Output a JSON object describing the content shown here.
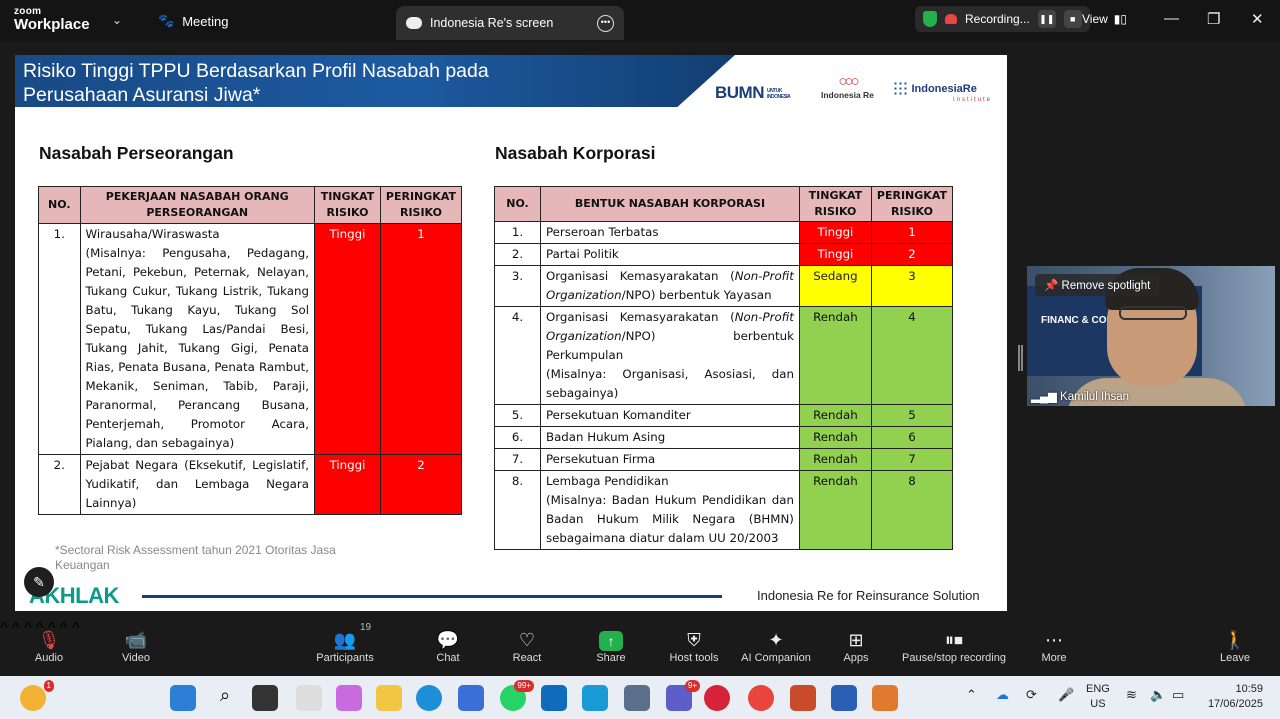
{
  "titlebar": {
    "brand_top": "zoom",
    "brand_bottom": "Workplace",
    "meeting_label": "Meeting",
    "tab_label": "Indonesia Re's screen",
    "recording_label": "Recording...",
    "view_label": "View"
  },
  "slide": {
    "title": "Risiko Tinggi TPPU Berdasarkan Profil Nasabah pada Perusahaan Asuransi Jiwa*",
    "logo_bumn": "BUMN",
    "logo_bumn_sub": "UNTUK INDONESIA",
    "logo_ire": "Indonesia Re",
    "logo_irei": "IndonesiaRe",
    "logo_irei_sub": "Institute",
    "left_title": "Nasabah Perseorangan",
    "right_title": "Nasabah Korporasi",
    "left_table": {
      "headers": [
        "NO.",
        "PEKERJAAN NASABAH ORANG PERSEORANGAN",
        "TINGKAT RISIKO",
        "PERINGKAT RISIKO"
      ],
      "rows": [
        {
          "no": "1.",
          "title": "Wirausaha/Wiraswasta",
          "detail": "(Misalnya: Pengusaha, Pedagang, Petani, Pekebun, Peternak, Nelayan, Tukang Cukur, Tukang Listrik, Tukang Batu, Tukang Kayu, Tukang Sol Sepatu, Tukang Las/Pandai Besi, Tukang Jahit, Tukang Gigi, Penata Rias, Penata Busana, Penata Rambut, Mekanik, Seniman, Tabib, Paraji, Paranormal, Perancang Busana, Penterjemah, Promotor Acara, Pialang, dan sebagainya)",
          "risk": "Tinggi",
          "rank": "1"
        },
        {
          "no": "2.",
          "title": "Pejabat Negara (Eksekutif, Legislatif, Yudikatif, dan Lembaga Negara Lainnya)",
          "detail": "",
          "risk": "Tinggi",
          "rank": "2"
        }
      ]
    },
    "right_table": {
      "headers": [
        "NO.",
        "BENTUK NASABAH KORPORASI",
        "TINGKAT RISIKO",
        "PERINGKAT RISIKO"
      ],
      "rows": [
        {
          "no": "1.",
          "text": "Perseroan Terbatas",
          "risk": "Tinggi",
          "rank": "1"
        },
        {
          "no": "2.",
          "text": "Partai Politik",
          "risk": "Tinggi",
          "rank": "2"
        },
        {
          "no": "3.",
          "text_a": "Organisasi Kemasyarakatan (",
          "text_i": "Non-Profit Organization",
          "text_b": "/NPO) berbentuk Yayasan",
          "risk": "Sedang",
          "rank": "3"
        },
        {
          "no": "4.",
          "text_a": "Organisasi Kemasyarakatan (",
          "text_i": "Non-Profit Organization",
          "text_b": "/NPO) berbentuk Perkumpulan",
          "detail": "(Misalnya: Organisasi, Asosiasi, dan sebagainya)",
          "risk": "Rendah",
          "rank": "4"
        },
        {
          "no": "5.",
          "text": "Persekutuan Komanditer",
          "risk": "Rendah",
          "rank": "5"
        },
        {
          "no": "6.",
          "text": "Badan Hukum Asing",
          "risk": "Rendah",
          "rank": "6"
        },
        {
          "no": "7.",
          "text": "Persekutuan Firma",
          "risk": "Rendah",
          "rank": "7"
        },
        {
          "no": "8.",
          "text": "Lembaga Pendidikan",
          "detail": "(Misalnya: Badan Hukum Pendidikan dan Badan Hukum Milik Negara (BHMN) sebagaimana diatur dalam UU 20/2003",
          "risk": "Rendah",
          "rank": "8"
        }
      ]
    },
    "footnote": "*Sectoral Risk Assessment tahun 2021 Otoritas Jasa Keuangan",
    "akhlak": "AKHLAK",
    "footer_text": "Indonesia Re for Reinsurance Solution"
  },
  "video": {
    "spotlight_label": "Remove spotlight",
    "participant_name": "Kamilul Ihsan",
    "bg_text": "FINANC & COMP"
  },
  "controls": {
    "audio": "Audio",
    "video": "Video",
    "participants": "Participants",
    "participants_count": "19",
    "chat": "Chat",
    "react": "React",
    "share": "Share",
    "host_tools": "Host tools",
    "ai_companion": "AI Companion",
    "apps": "Apps",
    "pause_stop": "Pause/stop recording",
    "more": "More",
    "leave": "Leave"
  },
  "taskbar": {
    "weather_badge": "1",
    "whatsapp_badge": "99+",
    "teams_badge": "9+",
    "lang_top": "ENG",
    "lang_bottom": "US",
    "time": "10:59",
    "date": "17/06/2025"
  },
  "colors": {
    "high": "#ff0000",
    "medium": "#ffff00",
    "low": "#92d050",
    "header_bg": "#e6b7b8",
    "slide_banner": "#1d5aa0"
  }
}
